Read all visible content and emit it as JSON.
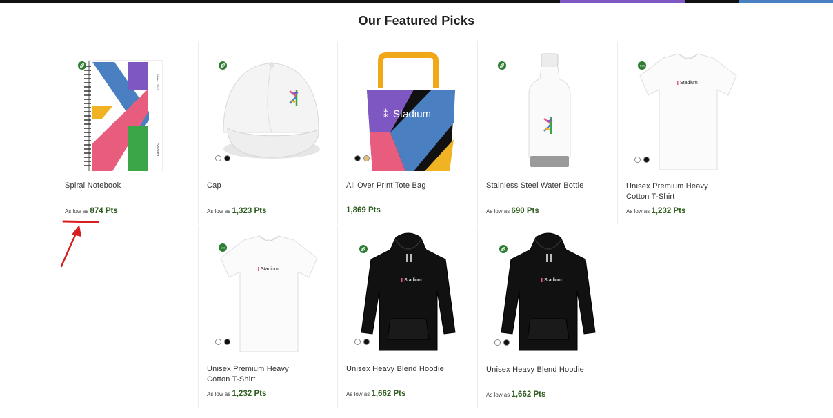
{
  "colors": {
    "points_green": "#2e5d1e",
    "eco_badge": "#2e7d32",
    "annotation_red": "#d81f1f"
  },
  "section": {
    "title": "Our Featured Picks"
  },
  "products": [
    {
      "name": "Spiral Notebook",
      "price_prefix": "As low as",
      "price": "874 Pts",
      "badge": "leaf-icon",
      "swatches": []
    },
    {
      "name": "Cap",
      "price_prefix": "As low as",
      "price": "1,323 Pts",
      "badge": "leaf-icon",
      "swatches": [
        "#ffffff",
        "#111111"
      ]
    },
    {
      "name": "All Over Print Tote Bag",
      "price_prefix": "",
      "price": "1,869 Pts",
      "badge": "",
      "swatches": [
        "#111111",
        "#e8c07a"
      ]
    },
    {
      "name": "Stainless Steel Water Bottle",
      "price_prefix": "As low as",
      "price": "690 Pts",
      "badge": "leaf-icon",
      "swatches": []
    },
    {
      "name": "Unisex Premium Heavy Cotton T-Shirt",
      "price_prefix": "As low as",
      "price": "1,232 Pts",
      "badge": "eco-icon",
      "swatches": [
        "#ffffff",
        "#111111"
      ]
    },
    {
      "name": "Unisex Premium Heavy Cotton T-Shirt",
      "price_prefix": "As low as",
      "price": "1,232 Pts",
      "badge": "eco-icon",
      "swatches": [
        "#ffffff",
        "#111111"
      ]
    },
    {
      "name": "Unisex Heavy Blend Hoodie",
      "price_prefix": "As low as",
      "price": "1,662 Pts",
      "badge": "leaf-icon",
      "swatches": [
        "#ffffff",
        "#111111"
      ]
    },
    {
      "name": "Unisex Heavy Blend Hoodie",
      "price_prefix": "As low as",
      "price": "1,662 Pts",
      "badge": "leaf-icon",
      "swatches": [
        "#ffffff",
        "#111111"
      ]
    }
  ],
  "brand": {
    "wordmark": "Stadium",
    "notebook_cover_text": "Notes / 2023"
  }
}
